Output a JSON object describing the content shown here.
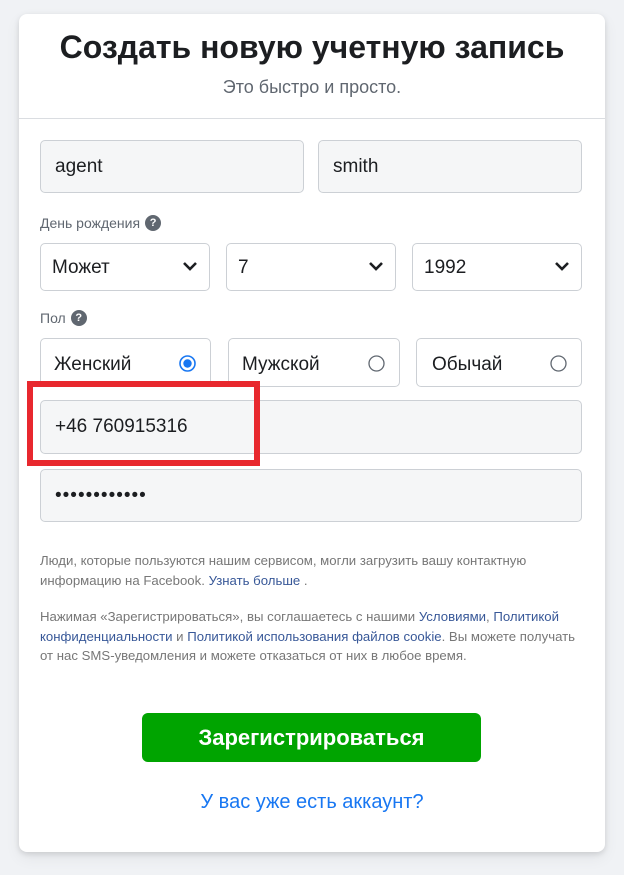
{
  "header": {
    "title": "Создать новую учетную запись",
    "subtitle": "Это быстро и просто."
  },
  "form": {
    "first_name": "agent",
    "last_name": "smith",
    "birthday_label": "День рождения",
    "birthday": {
      "month": "Может",
      "day": "7",
      "year": "1992"
    },
    "gender_label": "Пол",
    "gender_options": [
      {
        "label": "Женский",
        "selected": true
      },
      {
        "label": "Мужской",
        "selected": false
      },
      {
        "label": "Обычай",
        "selected": false
      }
    ],
    "phone": "+46 760915316",
    "password_masked": "••••••••••••"
  },
  "notice1": {
    "text": "Люди, которые пользуются нашим сервисом, могли загрузить вашу контактную информацию на Facebook.",
    "link": "Узнать больше",
    "end": "."
  },
  "notice2": {
    "text1": "Нажимая «Зарегистрироваться», вы соглашаетесь с нашими",
    "link1": "Условиями",
    "sep1": ",",
    "link2": "Политикой конфиденциальности",
    "and": "и",
    "link3": "Политикой использования файлов cookie",
    "text2": ". Вы можете получать от нас SMS-уведомления и можете отказаться от них в любое время."
  },
  "signup_label": "Зарегистрироваться",
  "have_account_label": "У вас уже есть аккаунт?",
  "colors": {
    "primary": "#00a400",
    "link": "#385898",
    "highlight": "#e8282e",
    "accent": "#1877f2"
  }
}
